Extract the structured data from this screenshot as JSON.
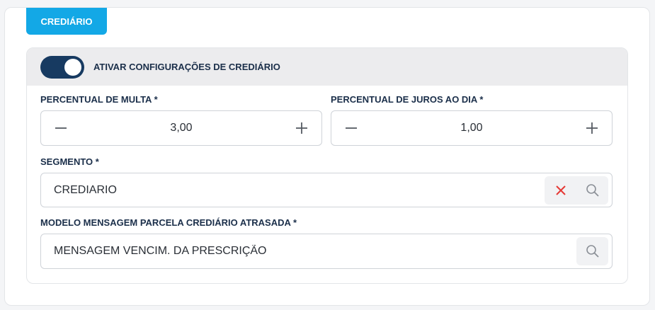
{
  "tab": {
    "label": "CREDIÁRIO"
  },
  "toggle": {
    "label": "ATIVAR CONFIGURAÇÕES DE CREDIÁRIO",
    "enabled": true
  },
  "multa": {
    "label": "PERCENTUAL DE MULTA *",
    "value": "3,00"
  },
  "juros": {
    "label": "PERCENTUAL DE JUROS AO DIA *",
    "value": "1,00"
  },
  "segmento": {
    "label": "SEGMENTO *",
    "value": "CREDIARIO"
  },
  "modelo": {
    "label": "MODELO MENSAGEM PARCELA CREDIÁRIO ATRASADA *",
    "value": "MENSAGEM VENCIM. DA PRESCRIÇÃO"
  },
  "icons": {
    "minus": "minus-icon",
    "plus": "plus-icon",
    "clear": "close-icon",
    "search": "search-icon"
  },
  "colors": {
    "accent": "#13a8e6",
    "toggle": "#173a61",
    "clear": "#e53935",
    "label": "#1b2f4a"
  }
}
